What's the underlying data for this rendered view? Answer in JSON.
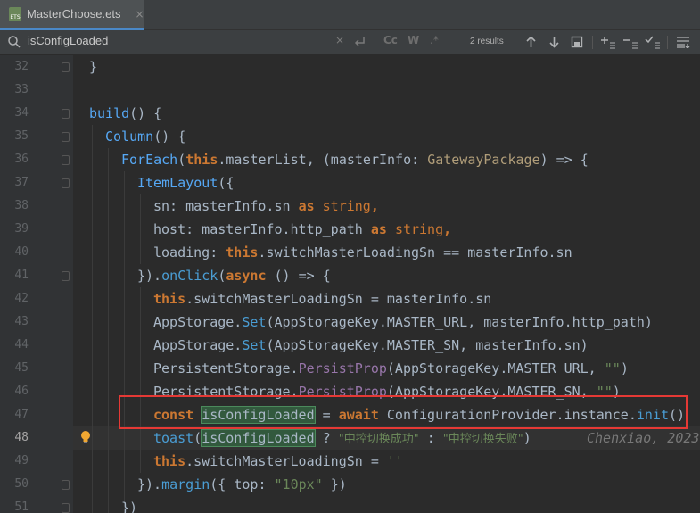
{
  "tab": {
    "filename": "MasterChoose.ets",
    "file_icon": "ets-file-icon",
    "close_glyph": "×"
  },
  "search": {
    "query": "isConfigLoaded",
    "clear_glyph": "×",
    "results": "2 results",
    "match_case": "Cc",
    "words": "W",
    "regex": ".*"
  },
  "editor": {
    "current_line": "48",
    "lines": [
      {
        "n": "32"
      },
      {
        "n": "33"
      },
      {
        "n": "34"
      },
      {
        "n": "35"
      },
      {
        "n": "36"
      },
      {
        "n": "37"
      },
      {
        "n": "38"
      },
      {
        "n": "39"
      },
      {
        "n": "40"
      },
      {
        "n": "41"
      },
      {
        "n": "42"
      },
      {
        "n": "43"
      },
      {
        "n": "44"
      },
      {
        "n": "45"
      },
      {
        "n": "46"
      },
      {
        "n": "47"
      },
      {
        "n": "48"
      },
      {
        "n": "49"
      },
      {
        "n": "50"
      },
      {
        "n": "51"
      }
    ],
    "text": {
      "l32": "}",
      "l34_a": "build",
      "l34_b": "() {",
      "l35_a": "Column",
      "l35_b": "() {",
      "l36_a": "ForEach",
      "l36_b": "(",
      "l36_c": "this",
      "l36_d": ".masterList, (masterInfo: ",
      "l36_e": "GatewayPackage",
      "l36_f": ") => {",
      "l37_a": "ItemLayout",
      "l37_b": "({",
      "l38_a": "sn: masterInfo.sn ",
      "l38_b": "as",
      "l38_c": " ",
      "l38_d": "string",
      "l38_e": ",",
      "l39_a": "host: masterInfo.http_path ",
      "l39_b": "as",
      "l39_c": " ",
      "l39_d": "string",
      "l39_e": ",",
      "l40_a": "loading: ",
      "l40_b": "this",
      "l40_c": ".switchMasterLoadingSn == masterInfo.sn",
      "l41_a": "}).",
      "l41_b": "onClick",
      "l41_c": "(",
      "l41_d": "async",
      "l41_e": " () => {",
      "l42_a": "this",
      "l42_b": ".switchMasterLoadingSn = masterInfo.sn",
      "l43_a": "AppStorage.",
      "l43_b": "Set",
      "l43_c": "(AppStorageKey.MASTER_URL, masterInfo.http_path)",
      "l44_a": "AppStorage.",
      "l44_b": "Set",
      "l44_c": "(AppStorageKey.MASTER_SN, masterInfo.sn)",
      "l45_a": "PersistentStorage.",
      "l45_b": "PersistProp",
      "l45_c": "(AppStorageKey.MASTER_URL, ",
      "l45_d": "\"\"",
      "l45_e": ")",
      "l46_a": "PersistentStorage.",
      "l46_b": "PersistProp",
      "l46_c": "(AppStorageKey.MASTER_SN, ",
      "l46_d": "\"\"",
      "l46_e": ")",
      "l47_a": "const",
      "l47_b": " ",
      "l47_c": "isConfigLoaded",
      "l47_d": " = ",
      "l47_e": "await",
      "l47_f": " ConfigurationProvider.instance.",
      "l47_g": "init",
      "l47_h": "()",
      "l48_a": "toast",
      "l48_b": "(",
      "l48_c": "isConfigLoaded",
      "l48_d": " ? ",
      "l48_e": "\"中控切换成功\"",
      "l48_f": " : ",
      "l48_g": "\"中控切换失败\"",
      "l48_h": ")",
      "l48_blame": "Chenxiao, 2023",
      "l49_a": "this",
      "l49_b": ".switchMasterLoadingSn = ",
      "l49_c": "''",
      "l50_a": "}).",
      "l50_b": "margin",
      "l50_c": "({ top: ",
      "l50_d": "\"10px\"",
      "l50_e": " })",
      "l51_a": "})"
    }
  },
  "colors": {
    "background": "#2b2b2b",
    "gutter": "#313335",
    "keyword": "#cc7832",
    "string": "#6a8759",
    "function": "#ffc66d",
    "highlight_box": "#e53935",
    "search_match": "#32593d"
  }
}
